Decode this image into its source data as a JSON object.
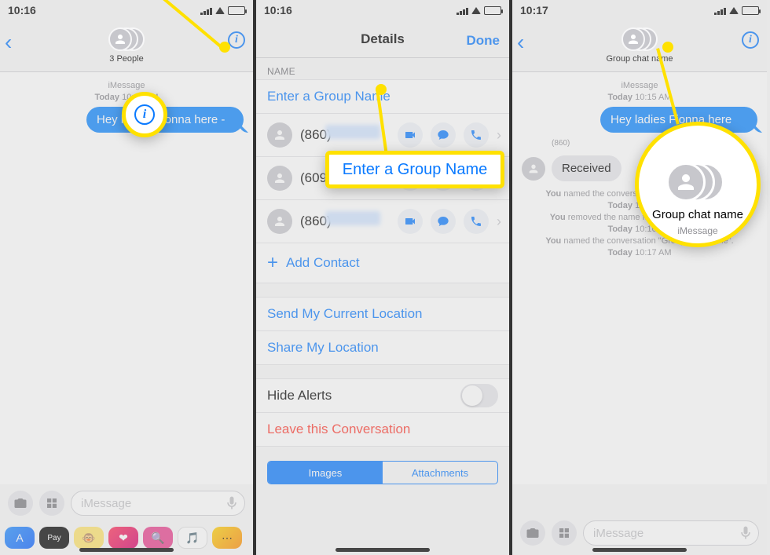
{
  "panel1": {
    "time": "10:16",
    "header_title": "3 People",
    "sys_line1": "iMessage",
    "sys_line2_prefix": "Today",
    "sys_line2_time": "10:15 AM",
    "bubble_text": "Hey ladies Fionna here -",
    "input_placeholder": "iMessage",
    "app_labels": [
      "Store",
      "Pay",
      "Memoji",
      "Digital Touch",
      "Images",
      "Music",
      "More"
    ]
  },
  "panel2": {
    "time": "10:16",
    "title": "Details",
    "done": "Done",
    "name_section_label": "NAME",
    "name_placeholder": "Enter a Group Name",
    "contacts": [
      {
        "num": "(860)"
      },
      {
        "num": "(609)"
      },
      {
        "num": "(860)"
      }
    ],
    "add_contact": "Add Contact",
    "send_location": "Send My Current Location",
    "share_location": "Share My Location",
    "hide_alerts": "Hide Alerts",
    "leave": "Leave this Conversation",
    "seg_images": "Images",
    "seg_attachments": "Attachments",
    "callout_text": "Enter a Group Name"
  },
  "panel3": {
    "time": "10:17",
    "header_title": "Group chat name",
    "sys_line1": "iMessage",
    "sys_line2_prefix": "Today",
    "sys_line2_time": "10:15 AM",
    "bubble_text": "Hey ladies Fionna here",
    "received_num": "(860)",
    "received_text": "Received",
    "events": [
      {
        "prefix": "You",
        "text": " named the conversation \"Group chat name\".",
        "time_prefix": "Today",
        "time": "10:15 AM"
      },
      {
        "prefix": "You",
        "text": " removed the name from this conversation.",
        "time_prefix": "Today",
        "time": "10:16 AM"
      },
      {
        "prefix": "You",
        "text": " named the conversation \"Group chat name\".",
        "time_prefix": "Today",
        "time": "10:17 AM"
      }
    ],
    "input_placeholder": "iMessage",
    "callout_title": "Group chat name",
    "callout_sub": "iMessage"
  }
}
